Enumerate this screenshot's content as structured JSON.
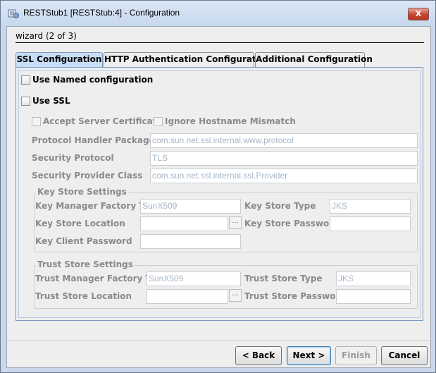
{
  "window": {
    "title": "RESTStub1 [RESTStub:4] - Configuration",
    "close_label": "X"
  },
  "wizard": {
    "step_label": "wizard (2 of 3)"
  },
  "tabs": [
    {
      "label": "SSL Configuration",
      "active": true
    },
    {
      "label": "HTTP Authentication Configuration",
      "active": false
    },
    {
      "label": "Additional Configuration",
      "active": false
    }
  ],
  "ssl": {
    "use_named_configuration": "Use Named configuration",
    "use_ssl": "Use SSL",
    "accept_server_certificate": "Accept Server Certificate",
    "ignore_hostname_mismatch": "Ignore Hostname Mismatch",
    "protocol_handler_packages": {
      "label": "Protocol Handler Packages",
      "value": "com.sun.net.ssl.internal.www.protocol"
    },
    "security_protocol": {
      "label": "Security Protocol",
      "value": "TLS"
    },
    "security_provider_class": {
      "label": "Security Provider Class",
      "value": "com.sun.net.ssl.internal.ssl.Provider"
    }
  },
  "key_store": {
    "title": "Key Store Settings",
    "key_manager_factory_type": {
      "label": "Key Manager Factory Type",
      "value": "SunX509"
    },
    "key_store_type": {
      "label": "Key Store Type",
      "value": "JKS"
    },
    "key_store_location": {
      "label": "Key Store Location",
      "value": ""
    },
    "key_store_password": {
      "label": "Key Store Password",
      "value": ""
    },
    "key_client_password": {
      "label": "Key Client Password",
      "value": ""
    }
  },
  "trust_store": {
    "title": "Trust Store Settings",
    "trust_manager_factory_type": {
      "label": "Trust Manager Factory Type",
      "value": "SunX509"
    },
    "trust_store_type": {
      "label": "Trust Store Type",
      "value": "JKS"
    },
    "trust_store_location": {
      "label": "Trust Store Location",
      "value": ""
    },
    "trust_store_password": {
      "label": "Trust Store Password",
      "value": ""
    }
  },
  "browse_label": "...",
  "buttons": {
    "back": "< Back",
    "next": "Next >",
    "finish": "Finish",
    "cancel": "Cancel"
  }
}
